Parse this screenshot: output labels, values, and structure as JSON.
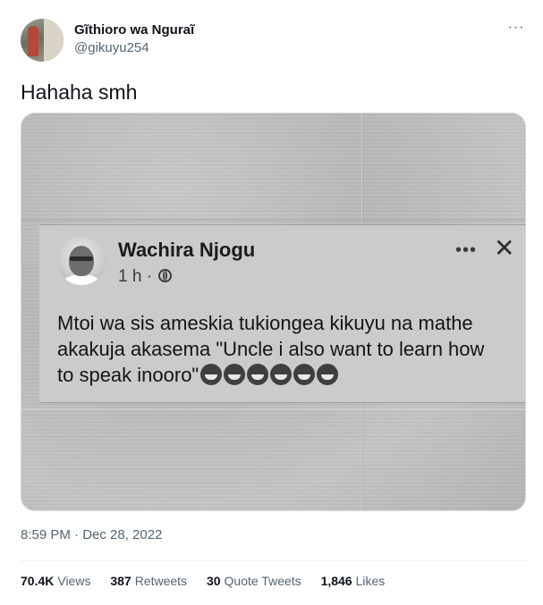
{
  "author": {
    "name": "Gĩthioro wa Nguraĩ",
    "handle": "@gikuyu254"
  },
  "tweet": {
    "text": "Hahaha smh",
    "timestamp": "8:59 PM · Dec 28, 2022"
  },
  "media": {
    "post": {
      "author_name": "Wachira Njogu",
      "time": "1 h ·",
      "lines": [
        "Mtoi wa sis ameskia tukiongea kikuyu na mathe",
        "akakuja akasema \"Uncle i also want to learn how",
        "to speak inooro\""
      ],
      "emojis": [
        "crying-laughing-emoji",
        "crying-laughing-emoji",
        "laughing-emoji",
        "laughing-emoji",
        "laughing-emoji",
        "laughing-emoji"
      ]
    }
  },
  "stats": {
    "views_count": "70.4K",
    "views_label": "Views",
    "retweets_count": "387",
    "retweets_label": "Retweets",
    "quotes_count": "30",
    "quotes_label": "Quote Tweets",
    "likes_count": "1,846",
    "likes_label": "Likes"
  },
  "colors": {
    "text_primary": "#0f1419",
    "text_secondary": "#536471",
    "divider": "#eff3f4"
  }
}
